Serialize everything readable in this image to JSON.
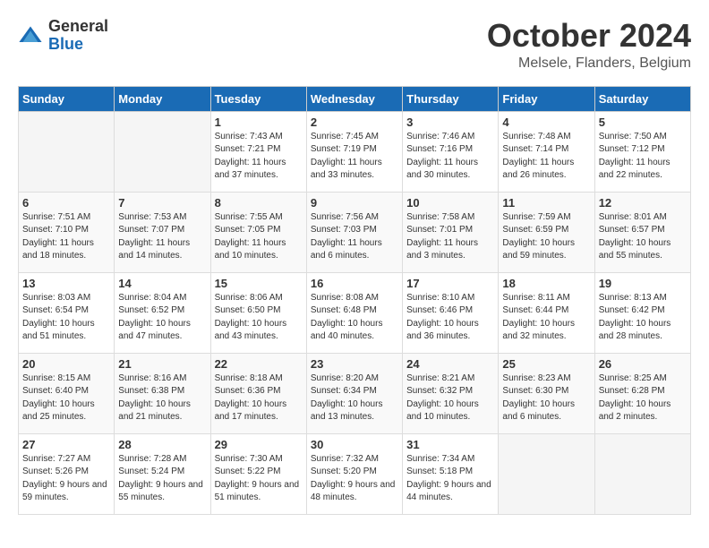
{
  "logo": {
    "general": "General",
    "blue": "Blue"
  },
  "title": "October 2024",
  "location": "Melsele, Flanders, Belgium",
  "days_of_week": [
    "Sunday",
    "Monday",
    "Tuesday",
    "Wednesday",
    "Thursday",
    "Friday",
    "Saturday"
  ],
  "weeks": [
    [
      {
        "day": "",
        "sunrise": "",
        "sunset": "",
        "daylight": ""
      },
      {
        "day": "",
        "sunrise": "",
        "sunset": "",
        "daylight": ""
      },
      {
        "day": "1",
        "sunrise": "Sunrise: 7:43 AM",
        "sunset": "Sunset: 7:21 PM",
        "daylight": "Daylight: 11 hours and 37 minutes."
      },
      {
        "day": "2",
        "sunrise": "Sunrise: 7:45 AM",
        "sunset": "Sunset: 7:19 PM",
        "daylight": "Daylight: 11 hours and 33 minutes."
      },
      {
        "day": "3",
        "sunrise": "Sunrise: 7:46 AM",
        "sunset": "Sunset: 7:16 PM",
        "daylight": "Daylight: 11 hours and 30 minutes."
      },
      {
        "day": "4",
        "sunrise": "Sunrise: 7:48 AM",
        "sunset": "Sunset: 7:14 PM",
        "daylight": "Daylight: 11 hours and 26 minutes."
      },
      {
        "day": "5",
        "sunrise": "Sunrise: 7:50 AM",
        "sunset": "Sunset: 7:12 PM",
        "daylight": "Daylight: 11 hours and 22 minutes."
      }
    ],
    [
      {
        "day": "6",
        "sunrise": "Sunrise: 7:51 AM",
        "sunset": "Sunset: 7:10 PM",
        "daylight": "Daylight: 11 hours and 18 minutes."
      },
      {
        "day": "7",
        "sunrise": "Sunrise: 7:53 AM",
        "sunset": "Sunset: 7:07 PM",
        "daylight": "Daylight: 11 hours and 14 minutes."
      },
      {
        "day": "8",
        "sunrise": "Sunrise: 7:55 AM",
        "sunset": "Sunset: 7:05 PM",
        "daylight": "Daylight: 11 hours and 10 minutes."
      },
      {
        "day": "9",
        "sunrise": "Sunrise: 7:56 AM",
        "sunset": "Sunset: 7:03 PM",
        "daylight": "Daylight: 11 hours and 6 minutes."
      },
      {
        "day": "10",
        "sunrise": "Sunrise: 7:58 AM",
        "sunset": "Sunset: 7:01 PM",
        "daylight": "Daylight: 11 hours and 3 minutes."
      },
      {
        "day": "11",
        "sunrise": "Sunrise: 7:59 AM",
        "sunset": "Sunset: 6:59 PM",
        "daylight": "Daylight: 10 hours and 59 minutes."
      },
      {
        "day": "12",
        "sunrise": "Sunrise: 8:01 AM",
        "sunset": "Sunset: 6:57 PM",
        "daylight": "Daylight: 10 hours and 55 minutes."
      }
    ],
    [
      {
        "day": "13",
        "sunrise": "Sunrise: 8:03 AM",
        "sunset": "Sunset: 6:54 PM",
        "daylight": "Daylight: 10 hours and 51 minutes."
      },
      {
        "day": "14",
        "sunrise": "Sunrise: 8:04 AM",
        "sunset": "Sunset: 6:52 PM",
        "daylight": "Daylight: 10 hours and 47 minutes."
      },
      {
        "day": "15",
        "sunrise": "Sunrise: 8:06 AM",
        "sunset": "Sunset: 6:50 PM",
        "daylight": "Daylight: 10 hours and 43 minutes."
      },
      {
        "day": "16",
        "sunrise": "Sunrise: 8:08 AM",
        "sunset": "Sunset: 6:48 PM",
        "daylight": "Daylight: 10 hours and 40 minutes."
      },
      {
        "day": "17",
        "sunrise": "Sunrise: 8:10 AM",
        "sunset": "Sunset: 6:46 PM",
        "daylight": "Daylight: 10 hours and 36 minutes."
      },
      {
        "day": "18",
        "sunrise": "Sunrise: 8:11 AM",
        "sunset": "Sunset: 6:44 PM",
        "daylight": "Daylight: 10 hours and 32 minutes."
      },
      {
        "day": "19",
        "sunrise": "Sunrise: 8:13 AM",
        "sunset": "Sunset: 6:42 PM",
        "daylight": "Daylight: 10 hours and 28 minutes."
      }
    ],
    [
      {
        "day": "20",
        "sunrise": "Sunrise: 8:15 AM",
        "sunset": "Sunset: 6:40 PM",
        "daylight": "Daylight: 10 hours and 25 minutes."
      },
      {
        "day": "21",
        "sunrise": "Sunrise: 8:16 AM",
        "sunset": "Sunset: 6:38 PM",
        "daylight": "Daylight: 10 hours and 21 minutes."
      },
      {
        "day": "22",
        "sunrise": "Sunrise: 8:18 AM",
        "sunset": "Sunset: 6:36 PM",
        "daylight": "Daylight: 10 hours and 17 minutes."
      },
      {
        "day": "23",
        "sunrise": "Sunrise: 8:20 AM",
        "sunset": "Sunset: 6:34 PM",
        "daylight": "Daylight: 10 hours and 13 minutes."
      },
      {
        "day": "24",
        "sunrise": "Sunrise: 8:21 AM",
        "sunset": "Sunset: 6:32 PM",
        "daylight": "Daylight: 10 hours and 10 minutes."
      },
      {
        "day": "25",
        "sunrise": "Sunrise: 8:23 AM",
        "sunset": "Sunset: 6:30 PM",
        "daylight": "Daylight: 10 hours and 6 minutes."
      },
      {
        "day": "26",
        "sunrise": "Sunrise: 8:25 AM",
        "sunset": "Sunset: 6:28 PM",
        "daylight": "Daylight: 10 hours and 2 minutes."
      }
    ],
    [
      {
        "day": "27",
        "sunrise": "Sunrise: 7:27 AM",
        "sunset": "Sunset: 5:26 PM",
        "daylight": "Daylight: 9 hours and 59 minutes."
      },
      {
        "day": "28",
        "sunrise": "Sunrise: 7:28 AM",
        "sunset": "Sunset: 5:24 PM",
        "daylight": "Daylight: 9 hours and 55 minutes."
      },
      {
        "day": "29",
        "sunrise": "Sunrise: 7:30 AM",
        "sunset": "Sunset: 5:22 PM",
        "daylight": "Daylight: 9 hours and 51 minutes."
      },
      {
        "day": "30",
        "sunrise": "Sunrise: 7:32 AM",
        "sunset": "Sunset: 5:20 PM",
        "daylight": "Daylight: 9 hours and 48 minutes."
      },
      {
        "day": "31",
        "sunrise": "Sunrise: 7:34 AM",
        "sunset": "Sunset: 5:18 PM",
        "daylight": "Daylight: 9 hours and 44 minutes."
      },
      {
        "day": "",
        "sunrise": "",
        "sunset": "",
        "daylight": ""
      },
      {
        "day": "",
        "sunrise": "",
        "sunset": "",
        "daylight": ""
      }
    ]
  ]
}
